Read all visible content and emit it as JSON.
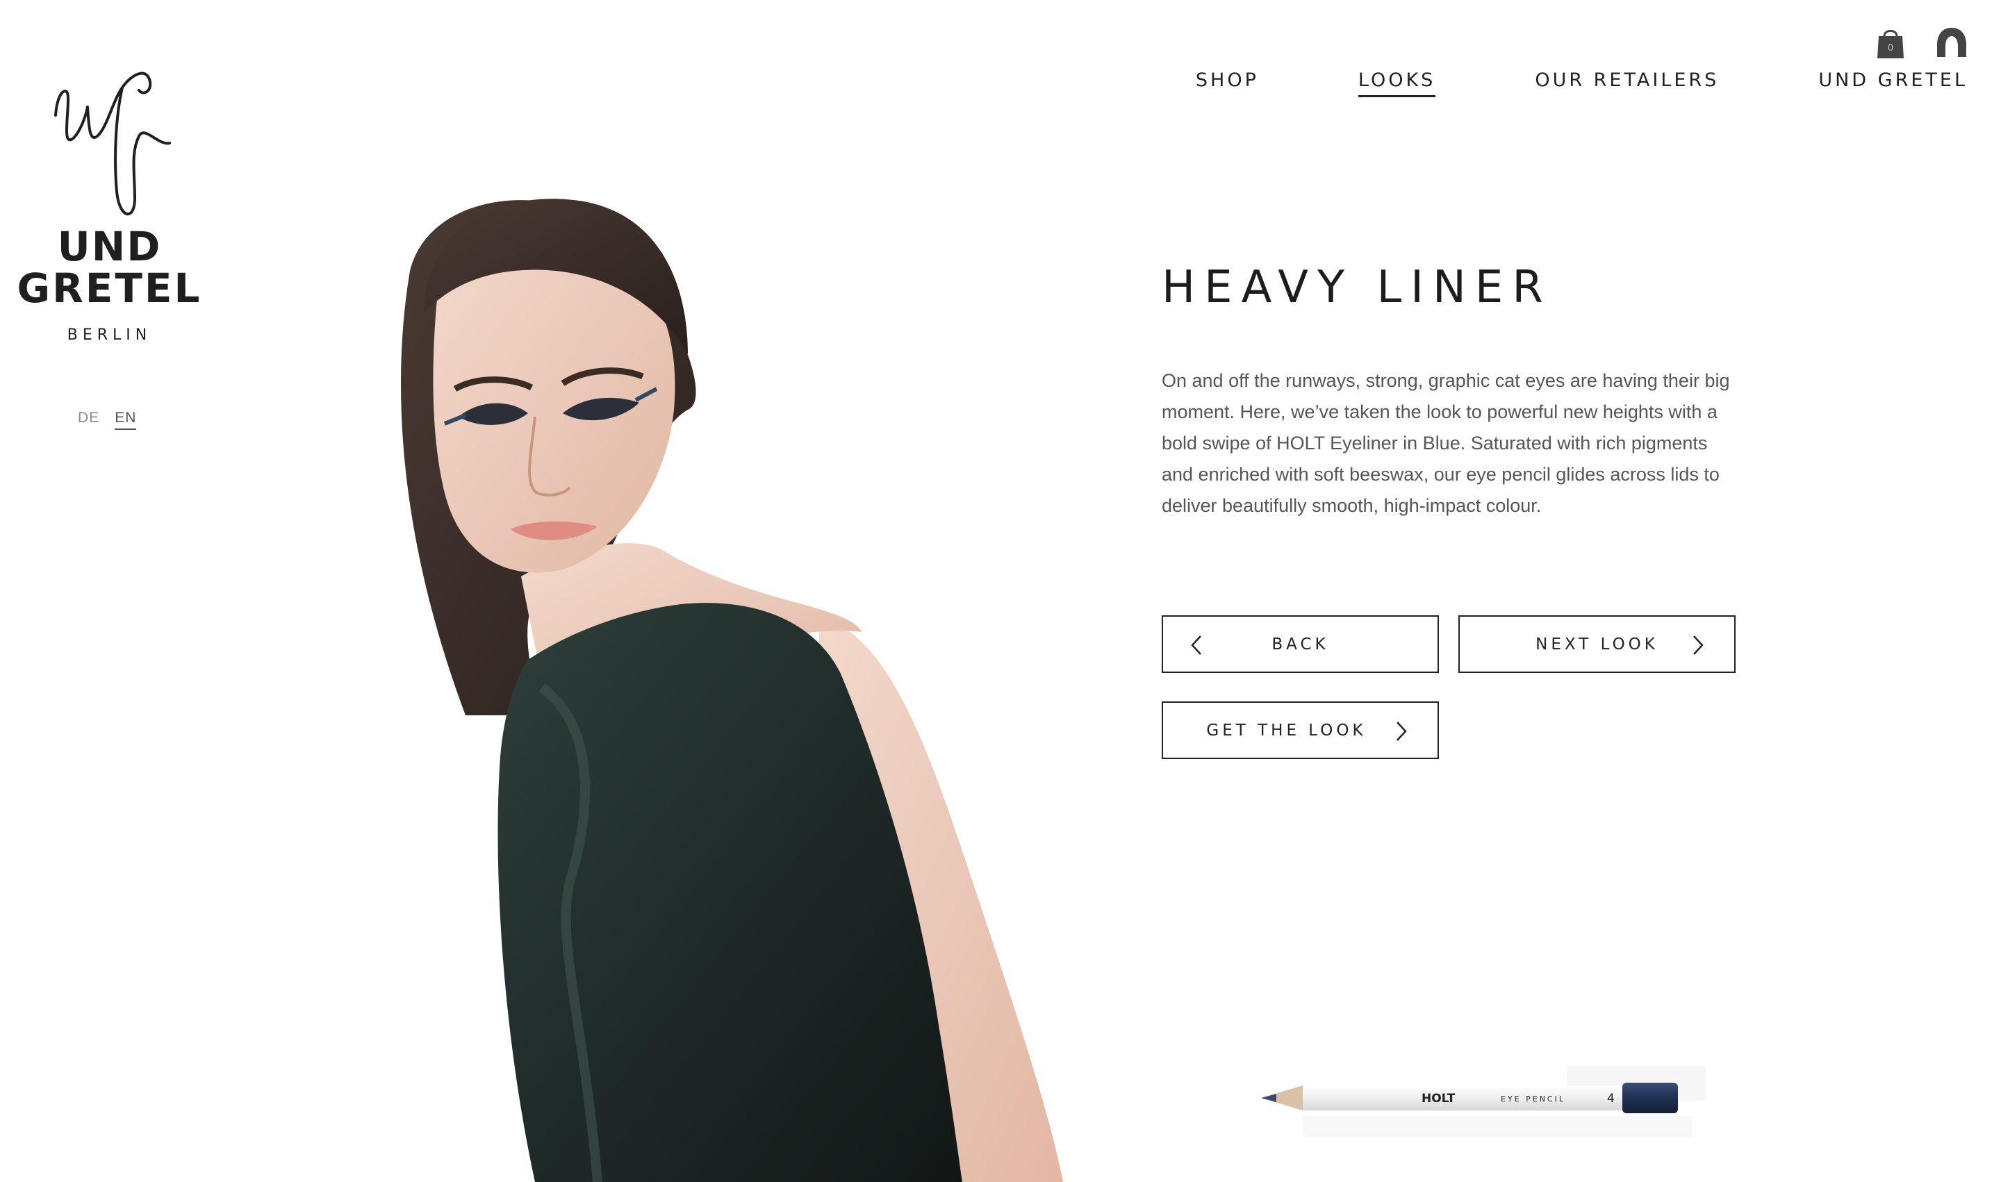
{
  "brand": {
    "monogram": "uG",
    "line1": "UND",
    "line2": "GRETEL",
    "city": "BERLIN"
  },
  "languages": [
    {
      "label": "DE",
      "active": false
    },
    {
      "label": "EN",
      "active": true
    }
  ],
  "nav": {
    "items": [
      {
        "label": "SHOP",
        "active": false
      },
      {
        "label": "LOOKS",
        "active": true
      },
      {
        "label": "OUR RETAILERS",
        "active": false
      },
      {
        "label": "UND GRETEL",
        "active": false
      }
    ]
  },
  "header_icons": {
    "cart_icon": "shopping-bag-icon",
    "cart_count": "0",
    "account_icon": "user-icon"
  },
  "look": {
    "title": "HEAVY LINER",
    "description": "On and off the runways, strong, graphic cat eyes are having their big moment. Here, we’ve taken the look to powerful new heights with a bold swipe of HOLT Eyeliner in Blue. Saturated with rich pigments and enriched with soft beeswax, our eye pencil glides across lids to deliver beautifully smooth, high-impact colour."
  },
  "buttons": {
    "back": "BACK",
    "next": "NEXT LOOK",
    "get_look": "GET THE LOOK"
  },
  "product": {
    "brand": "HOLT",
    "type": "EYE PENCIL",
    "number": "4",
    "colors": {
      "tip": "#3d4a6b",
      "cap": "#1f2f52",
      "body": "#efefef"
    }
  },
  "colors": {
    "text": "#222222",
    "muted": "#555555",
    "dress": "#1f2b29"
  }
}
